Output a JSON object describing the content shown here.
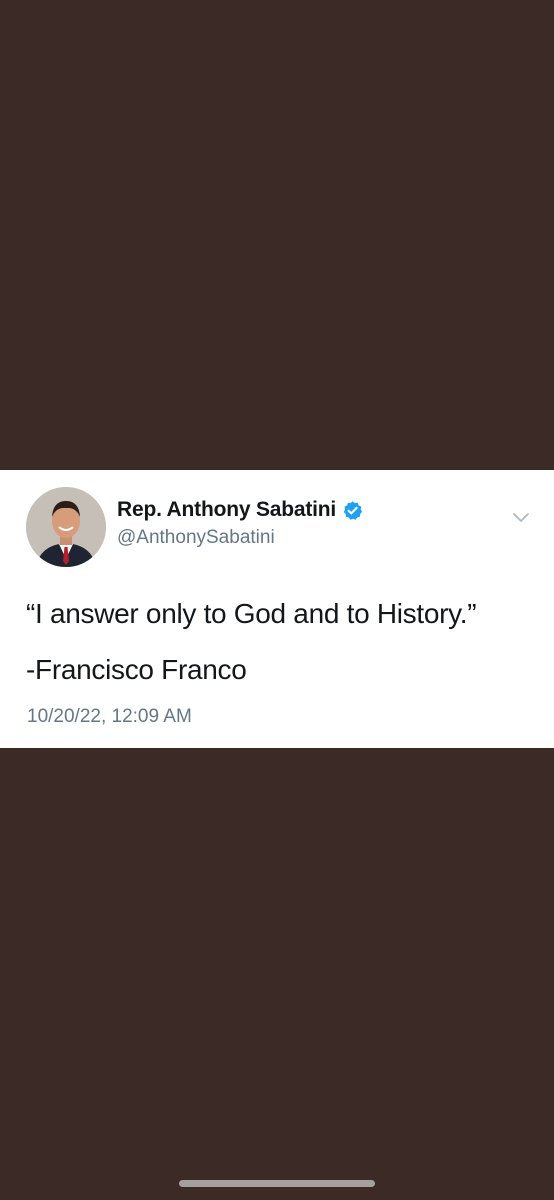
{
  "tweet": {
    "author": {
      "display_name": "Rep. Anthony Sabatini",
      "handle": "@AnthonySabatini",
      "verified": true,
      "avatar_icon": "profile-photo"
    },
    "text_lines": [
      "“I answer only to God and to History.”",
      "-Francisco Franco"
    ],
    "timestamp": "10/20/22, 12:09 AM",
    "menu_icon": "chevron-down-icon"
  },
  "colors": {
    "background": "#3c2a27",
    "card": "#ffffff",
    "primary_text": "#14171a",
    "secondary_text": "#657786",
    "verified_blue": "#1da1f2"
  }
}
